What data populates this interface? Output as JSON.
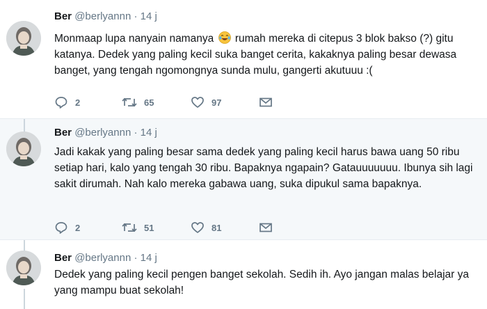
{
  "tweets": [
    {
      "name": "Ber",
      "handle": "@berlyannn",
      "dot": "·",
      "time": "14 j",
      "text_before_emoji": "Monmaap lupa nanyain namanya",
      "emoji": "face-with-tears-of-joy",
      "text_after_emoji": "rumah mereka di citepus 3 blok bakso (?) gitu katanya. Dedek yang paling kecil suka banget cerita, kakaknya paling besar dewasa banget, yang tengah ngomongnya sunda mulu, gangerti akutuuu :(",
      "replies": "2",
      "retweets": "65",
      "likes": "97"
    },
    {
      "name": "Ber",
      "handle": "@berlyannn",
      "dot": "·",
      "time": "14 j",
      "text": "Jadi kakak yang paling besar sama dedek yang paling kecil harus bawa uang 50 ribu setiap hari, kalo yang tengah 30 ribu. Bapaknya ngapain? Gatauuuuuuu. Ibunya sih lagi sakit dirumah. Nah kalo mereka gabawa uang, suka dipukul sama bapaknya.",
      "replies": "2",
      "retweets": "51",
      "likes": "81"
    },
    {
      "name": "Ber",
      "handle": "@berlyannn",
      "dot": "·",
      "time": "14 j",
      "text": "Dedek yang paling kecil pengen banget sekolah. Sedih ih. Ayo jangan malas belajar ya yang mampu buat sekolah!"
    }
  ],
  "icons": {
    "reply": "reply-icon",
    "retweet": "retweet-icon",
    "like": "heart-icon",
    "message": "envelope-icon"
  },
  "colors": {
    "text": "#14171a",
    "secondary": "#657786",
    "divider": "#e6ecf0",
    "alt_background": "#f5f8fa"
  }
}
